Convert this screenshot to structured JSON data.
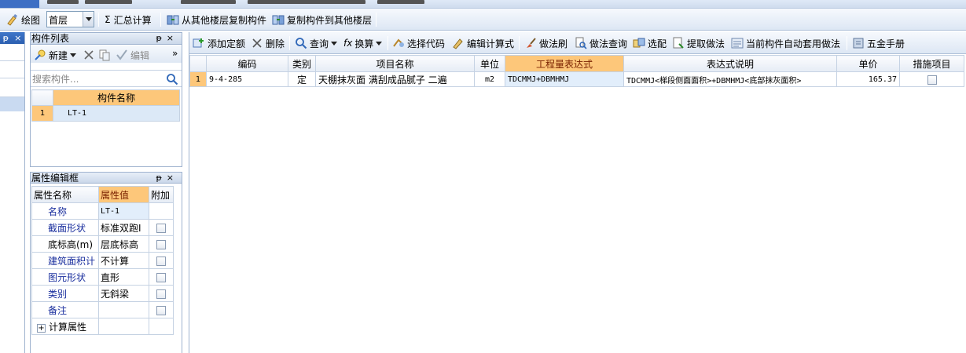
{
  "toolbar1": {
    "draw": "绘图",
    "floor": "首层",
    "sum": "汇总计算",
    "copy_from": "从其他楼层复制构件",
    "copy_to": "复制构件到其他楼层"
  },
  "left_pane": {
    "pin": "ᵽ",
    "close": "×"
  },
  "component_list": {
    "title": "构件列表",
    "pin": "ᵽ",
    "close": "×",
    "new_label": "新建",
    "edit_label": "编辑",
    "more": "»",
    "search_placeholder": "搜索构件...",
    "column": "构件名称",
    "rows": [
      {
        "index": "1",
        "name": "LT-1"
      }
    ]
  },
  "property_panel": {
    "title": "属性编辑框",
    "pin": "ᵽ",
    "close": "×",
    "headers": {
      "name": "属性名称",
      "value": "属性值",
      "extra": "附加"
    },
    "rows": [
      {
        "name": "名称",
        "value": "LT-1"
      },
      {
        "name": "截面形状",
        "value": "标准双跑I"
      },
      {
        "name": "底标高(m)",
        "value": "层底标高"
      },
      {
        "name": "建筑面积计",
        "value": "不计算"
      },
      {
        "name": "图元形状",
        "value": "直形"
      },
      {
        "name": "类别",
        "value": "无斜梁"
      },
      {
        "name": "备注",
        "value": ""
      }
    ],
    "calc_group": "计算属性",
    "expander": "+"
  },
  "toolbar2": {
    "add_quota": "添加定额",
    "delete": "删除",
    "query": "查询",
    "convert": "换算",
    "select_code": "选择代码",
    "edit_formula": "编辑计算式",
    "method_brush": "做法刷",
    "method_query": "做法查询",
    "match": "选配",
    "extract": "提取做法",
    "auto_apply": "当前构件自动套用做法",
    "hardware": "五金手册"
  },
  "grid": {
    "headers": {
      "code": "编码",
      "type": "类别",
      "item": "项目名称",
      "unit": "单位",
      "expr": "工程量表达式",
      "desc": "表达式说明",
      "price": "单价",
      "measure": "措施项目"
    },
    "rows": [
      {
        "index": "1",
        "code": "9-4-285",
        "type": "定",
        "item": "天棚抹灰面 满刮成品腻子 二遍",
        "unit": "m2",
        "expr": "TDCMMJ+DBMHMJ",
        "desc": "TDCMMJ<梯段侧面面积>+DBMHMJ<底部抹灰面积>",
        "price": "165.37"
      }
    ]
  },
  "colors": {
    "accent_header": "#fdc77a",
    "selected_row": "#dce9f7",
    "highlight_cell": "#e2eefb"
  }
}
